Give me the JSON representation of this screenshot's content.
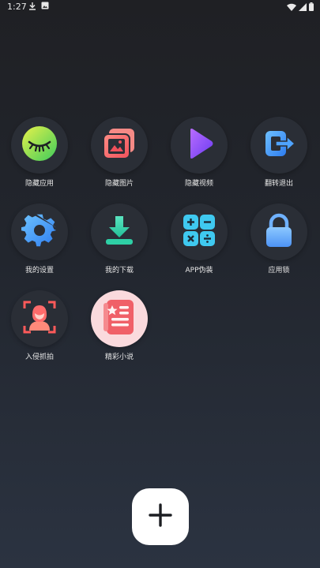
{
  "status_bar": {
    "time": "1:27",
    "left_icons": [
      "download-icon",
      "image-notification-icon"
    ],
    "right_icons": [
      "wifi-icon",
      "signal-icon",
      "battery-icon"
    ]
  },
  "apps": [
    {
      "label": "隐藏应用",
      "icon": "eye-closed-icon"
    },
    {
      "label": "隐藏图片",
      "icon": "photos-icon"
    },
    {
      "label": "隐藏视频",
      "icon": "play-icon"
    },
    {
      "label": "翻转退出",
      "icon": "exit-icon"
    },
    {
      "label": "我的设置",
      "icon": "gear-icon"
    },
    {
      "label": "我的下载",
      "icon": "download-icon"
    },
    {
      "label": "APP伪装",
      "icon": "calculator-icon"
    },
    {
      "label": "应用锁",
      "icon": "lock-icon"
    },
    {
      "label": "入侵抓拍",
      "icon": "intruder-icon"
    },
    {
      "label": "精彩小说",
      "icon": "novel-icon"
    }
  ],
  "fab": {
    "icon": "plus-icon"
  },
  "colors": {
    "background_top": "#1f2024",
    "background_bottom": "#2b3341",
    "icon_circle": "#2a2e36",
    "fab": "#ffffff"
  }
}
